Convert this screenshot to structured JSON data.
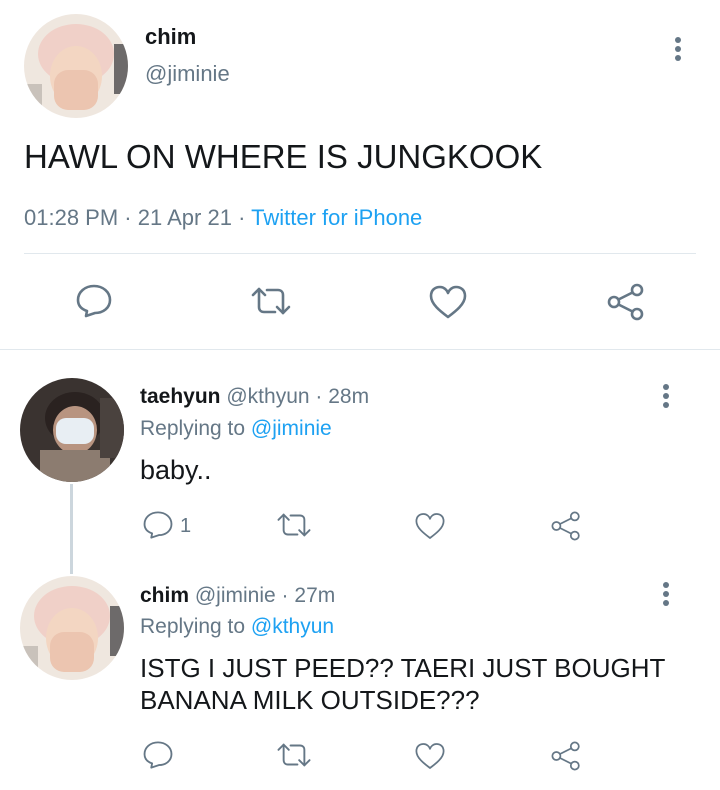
{
  "main_tweet": {
    "author_name": "chim",
    "author_handle": "@jiminie",
    "text": "HAWL ON WHERE IS JUNGKOOK",
    "time": "01:28 PM",
    "sep1": "·",
    "date": "21 Apr 21",
    "sep2": "·",
    "source": "Twitter for iPhone",
    "actions": [
      "reply-icon",
      "retweet-icon",
      "like-icon",
      "share-icon"
    ]
  },
  "replies": [
    {
      "author_name": "taehyun",
      "author_handle": "@kthyun",
      "sep": "·",
      "age": "28m",
      "replying_prefix": "Replying to",
      "replying_to": "@jiminie",
      "text": "baby..",
      "reply_count": "1"
    },
    {
      "author_name": "chim",
      "author_handle": "@jiminie",
      "sep": "·",
      "age": "27m",
      "replying_prefix": "Replying to",
      "replying_to": "@kthyun",
      "text_line1": "ISTG I JUST PEED?? TAERI JUST BOUGHT",
      "text_line2": "BANANA MILK OUTSIDE???",
      "reply_count": ""
    }
  ],
  "colors": {
    "text": "#14171a",
    "muted": "#657786",
    "link": "#1da1f2",
    "divider": "#e1e8ed"
  }
}
